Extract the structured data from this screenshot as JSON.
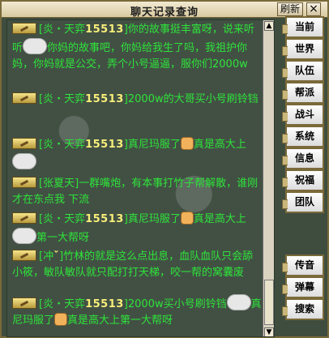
{
  "window": {
    "title": "聊天记录查询",
    "refresh_label": "刷新",
    "close_label": "×"
  },
  "chat": {
    "messages": [
      {
        "channel_icon": "channel-badge-icon",
        "sender_prefix": "[炎・天弈",
        "sender_num": "15513",
        "sender_suffix": "]",
        "text_1": "你的故事挺丰富呀，说来听听",
        "emoji": "cry-emoji-icon",
        "text_2": "你妈的故事吧，你妈给我生了吗，我祖护你妈，你妈就是公交，弄个小号逼逼，服你们2000w"
      },
      {
        "channel_icon": "channel-badge-icon",
        "sender_prefix": "[炎・天弈",
        "sender_num": "15513",
        "sender_suffix": "]",
        "text_1": "2000w的大哥买小号刷铃铛"
      },
      {
        "channel_icon": "channel-badge-icon",
        "sender_prefix": "[炎・天弈",
        "sender_num": "15513",
        "sender_suffix": "]",
        "text_1": "真尼玛服了",
        "thumb": "thumbs-up-icon",
        "text_2": "真是高大上",
        "emoji": "cry-emoji-icon"
      },
      {
        "channel_icon": "channel-badge-icon",
        "sender_prefix": "[张夏天",
        "sender_num": "",
        "sender_suffix": "]",
        "text_1": "一群嘴炮，有本事打竹子帮解散，谁刚才在东点我 下流"
      },
      {
        "channel_icon": "channel-badge-icon",
        "sender_prefix": "[炎・天弈",
        "sender_num": "15513",
        "sender_suffix": "]",
        "text_1": "真尼玛服了",
        "thumb": "thumbs-up-icon",
        "text_2": "真是高大上",
        "emoji": "cry-emoji-icon",
        "text_3": "第一大帮呀"
      },
      {
        "channel_icon": "channel-badge-icon",
        "sender_prefix": "[冲",
        "sender_num": "ˇ",
        "sender_suffix": "]",
        "text_1": "竹林的就是这么点出息，血队血队只会舔小筱，敏队敏队就只配打打天梯，咬一帮的窝囊废"
      },
      {
        "channel_icon": "channel-badge-icon",
        "sender_prefix": "[炎・天弈",
        "sender_num": "15513",
        "sender_suffix": "]",
        "text_1": "2000w买小号刷铃铛",
        "emoji": "cry-emoji-icon",
        "text_2": "真尼玛服了",
        "thumb": "thumbs-up-icon",
        "text_3": "真是高大上",
        "text_4": "第一大帮呀"
      }
    ]
  },
  "sidebar": {
    "tabs": [
      {
        "label": "当前"
      },
      {
        "label": "世界"
      },
      {
        "label": "队伍"
      },
      {
        "label": "帮派"
      },
      {
        "label": "战斗"
      },
      {
        "label": "系统"
      },
      {
        "label": "信息"
      },
      {
        "label": "祝福"
      },
      {
        "label": "团队"
      },
      {
        "label": "传音"
      },
      {
        "label": "弹幕"
      },
      {
        "label": "搜索"
      }
    ]
  }
}
